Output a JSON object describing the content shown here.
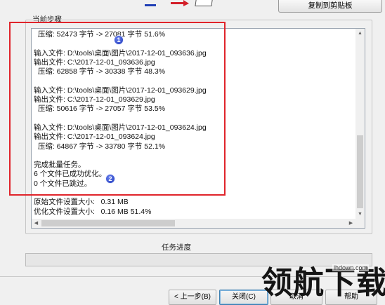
{
  "toolbar": {
    "copy_button_label": "复制到剪贴板"
  },
  "log": {
    "section_label": "当前步骤",
    "lines": [
      "  压缩: 52473 字节 -> 27081 字节 51.6%",
      "",
      "输入文件: D:\\tools\\桌面\\图片\\2017-12-01_093636.jpg",
      "输出文件: C:\\2017-12-01_093636.jpg",
      "  压缩: 62858 字节 -> 30338 字节 48.3%",
      "",
      "输入文件: D:\\tools\\桌面\\图片\\2017-12-01_093629.jpg",
      "输出文件: C:\\2017-12-01_093629.jpg",
      "  压缩: 50616 字节 -> 27057 字节 53.5%",
      "",
      "输入文件: D:\\tools\\桌面\\图片\\2017-12-01_093624.jpg",
      "输出文件: C:\\2017-12-01_093624.jpg",
      "  压缩: 64867 字节 -> 33780 字节 52.1%",
      "",
      "完成批量任务。",
      "6 个文件已成功优化。",
      "0 个文件已跳过。",
      "",
      "原始文件设置大小:   0.31 MB",
      "优化文件设置大小:   0.16 MB 51.4%"
    ]
  },
  "annotations": {
    "badge_1": "1",
    "badge_2": "2",
    "highlight_color": "#e0242b",
    "badge_color": "#1c36b8"
  },
  "progress": {
    "label": "任务进度",
    "value_percent": 0,
    "fill_color": "#06b025"
  },
  "footer": {
    "prev_label": "< 上一步(B)",
    "close_label": "关闭(C)",
    "cancel_label": "取消",
    "help_label": "帮助"
  },
  "watermark": {
    "text": "领航下载",
    "domain": "lhdown.com"
  }
}
